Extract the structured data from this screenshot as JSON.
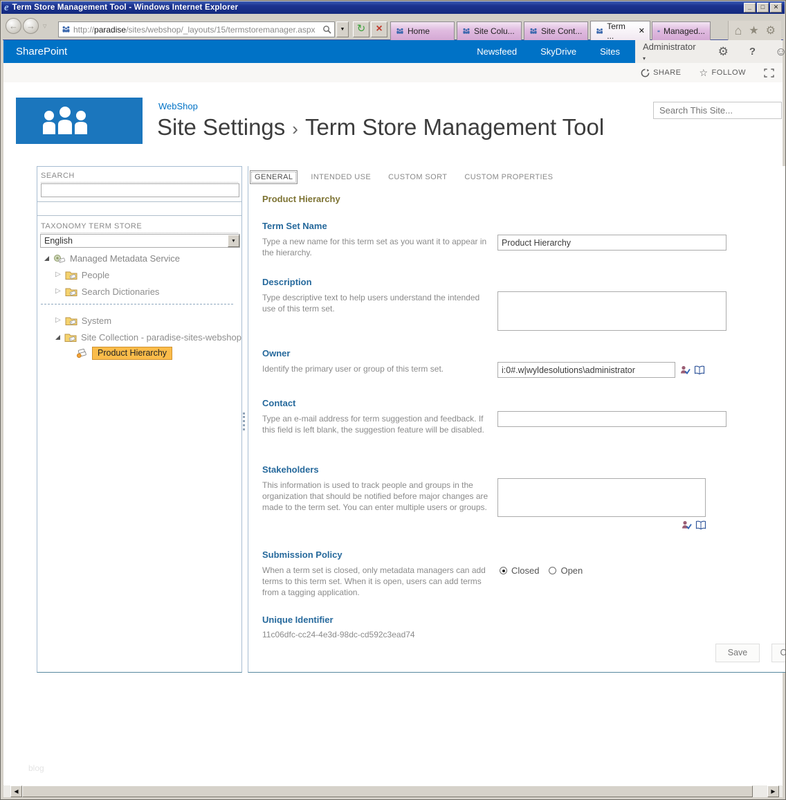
{
  "window": {
    "title": "Term Store Management Tool - Windows Internet Explorer"
  },
  "browser": {
    "url_protocol": "http://",
    "url_host": "paradise",
    "url_path": "/sites/webshop/_layouts/15/termstoremanager.aspx",
    "tabs": [
      {
        "label": "Home"
      },
      {
        "label": "Site Colu..."
      },
      {
        "label": "Site Cont..."
      },
      {
        "label": "Term ...",
        "active": true
      },
      {
        "label": "Managed..."
      }
    ]
  },
  "suite_bar": {
    "brand": "SharePoint",
    "links": [
      {
        "label": "Newsfeed"
      },
      {
        "label": "SkyDrive"
      },
      {
        "label": "Sites"
      }
    ],
    "user": "Administrator"
  },
  "actions": {
    "share": "SHARE",
    "follow": "FOLLOW"
  },
  "page": {
    "site_link": "WebShop",
    "title_prefix": "Site Settings",
    "title_separator": "›",
    "title": "Term Store Management Tool",
    "search_placeholder": "Search This Site..."
  },
  "left_pane": {
    "search_label": "SEARCH",
    "taxonomy_label": "TAXONOMY TERM STORE",
    "language": "English",
    "tree": [
      {
        "label": "Managed Metadata Service",
        "expanded": true
      },
      {
        "label": "People",
        "expanded": false
      },
      {
        "label": "Search Dictionaries",
        "expanded": false
      },
      {
        "label": "System",
        "expanded": false
      },
      {
        "label": "Site Collection - paradise-sites-webshop",
        "expanded": true
      },
      {
        "label": "Product Hierarchy",
        "selected": true
      }
    ]
  },
  "detail_tabs": [
    {
      "label": "GENERAL",
      "active": true
    },
    {
      "label": "INTENDED USE"
    },
    {
      "label": "CUSTOM SORT"
    },
    {
      "label": "CUSTOM PROPERTIES"
    }
  ],
  "form": {
    "title": "Product Hierarchy",
    "term_set_name": {
      "heading": "Term Set Name",
      "description": "Type a new name for this term set as you want it to appear in the hierarchy.",
      "value": "Product Hierarchy"
    },
    "description": {
      "heading": "Description",
      "description": "Type descriptive text to help users understand the intended use of this term set.",
      "value": ""
    },
    "owner": {
      "heading": "Owner",
      "description": "Identify the primary user or group of this term set.",
      "value": "i:0#.w|wyldesolutions\\administrator"
    },
    "contact": {
      "heading": "Contact",
      "description": "Type an e-mail address for term suggestion and feedback. If this field is left blank, the suggestion feature will be disabled.",
      "value": ""
    },
    "stakeholders": {
      "heading": "Stakeholders",
      "description": "This information is used to track people and groups in the organization that should be notified before major changes are made to the term set. You can enter multiple users or groups.",
      "value": ""
    },
    "submission_policy": {
      "heading": "Submission Policy",
      "description": "When a term set is closed, only metadata managers can add terms to this term set. When it is open, users can add terms from a tagging application.",
      "options": [
        {
          "label": "Closed",
          "selected": true
        },
        {
          "label": "Open",
          "selected": false
        }
      ]
    },
    "unique_identifier": {
      "heading": "Unique Identifier",
      "value": "11c06dfc-cc24-4e3d-98dc-cd592c3ead74"
    },
    "buttons": {
      "save": "Save",
      "cancel": "Cancel"
    }
  },
  "footer": {
    "watermark": "blog"
  },
  "colors": {
    "suite_blue": "#0072c6",
    "selection_orange": "#fbbc4a",
    "heading_blue": "#26699c",
    "form_title_olive": "#7d7333",
    "tab_pink": "#ddb9dd"
  }
}
